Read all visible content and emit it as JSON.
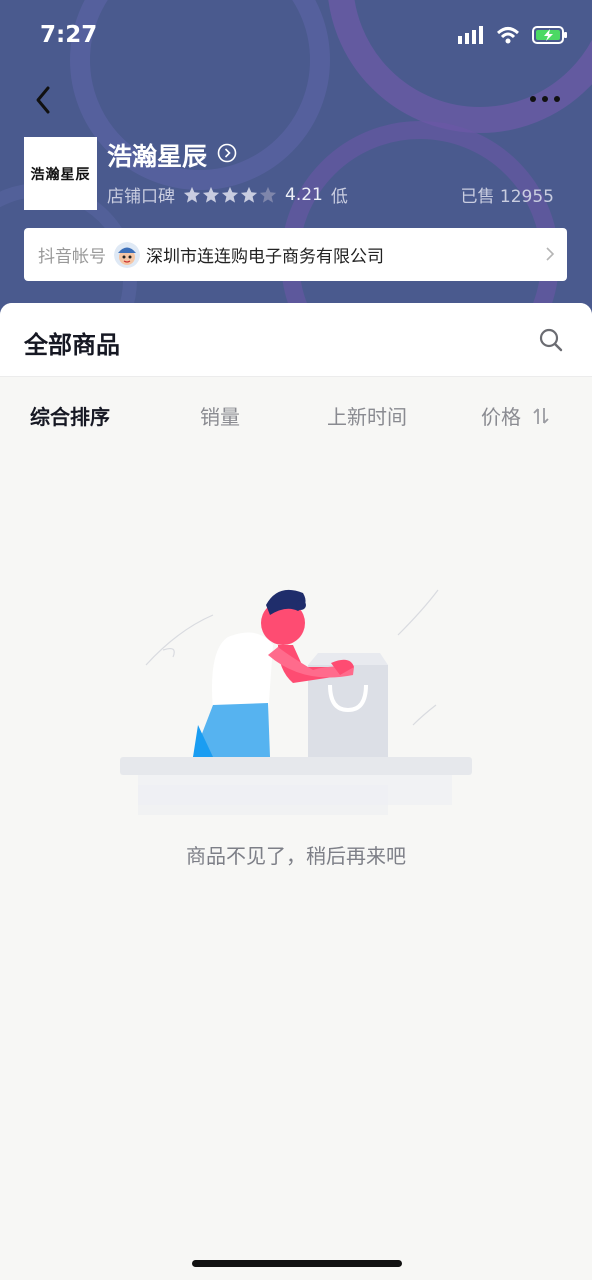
{
  "status_bar": {
    "time": "7:27"
  },
  "shop": {
    "logo_text": "浩瀚星辰",
    "name": "浩瀚星辰",
    "rating_label": "店铺口碑",
    "rating_value": "4.21",
    "rating_level": "低",
    "rating_stars": 4.21,
    "sold": "已售 12955"
  },
  "account": {
    "label": "抖音帐号",
    "name": "深圳市连连购电子商务有限公司"
  },
  "products": {
    "title": "全部商品",
    "sort_options": [
      "综合排序",
      "销量",
      "上新时间",
      "价格"
    ],
    "empty_message": "商品不见了，稍后再来吧"
  },
  "colors": {
    "header_bg": "#4a5a8e",
    "accent_pink": "#fe2c55",
    "accent_blue": "#1a9df2"
  },
  "icons": [
    "location-arrow-icon",
    "signal-icon",
    "wifi-icon",
    "battery-charging-icon",
    "back-arrow-icon",
    "more-icon",
    "circle-chevron-icon",
    "star-icon",
    "chevron-right-icon",
    "search-icon",
    "sort-arrows-icon"
  ]
}
